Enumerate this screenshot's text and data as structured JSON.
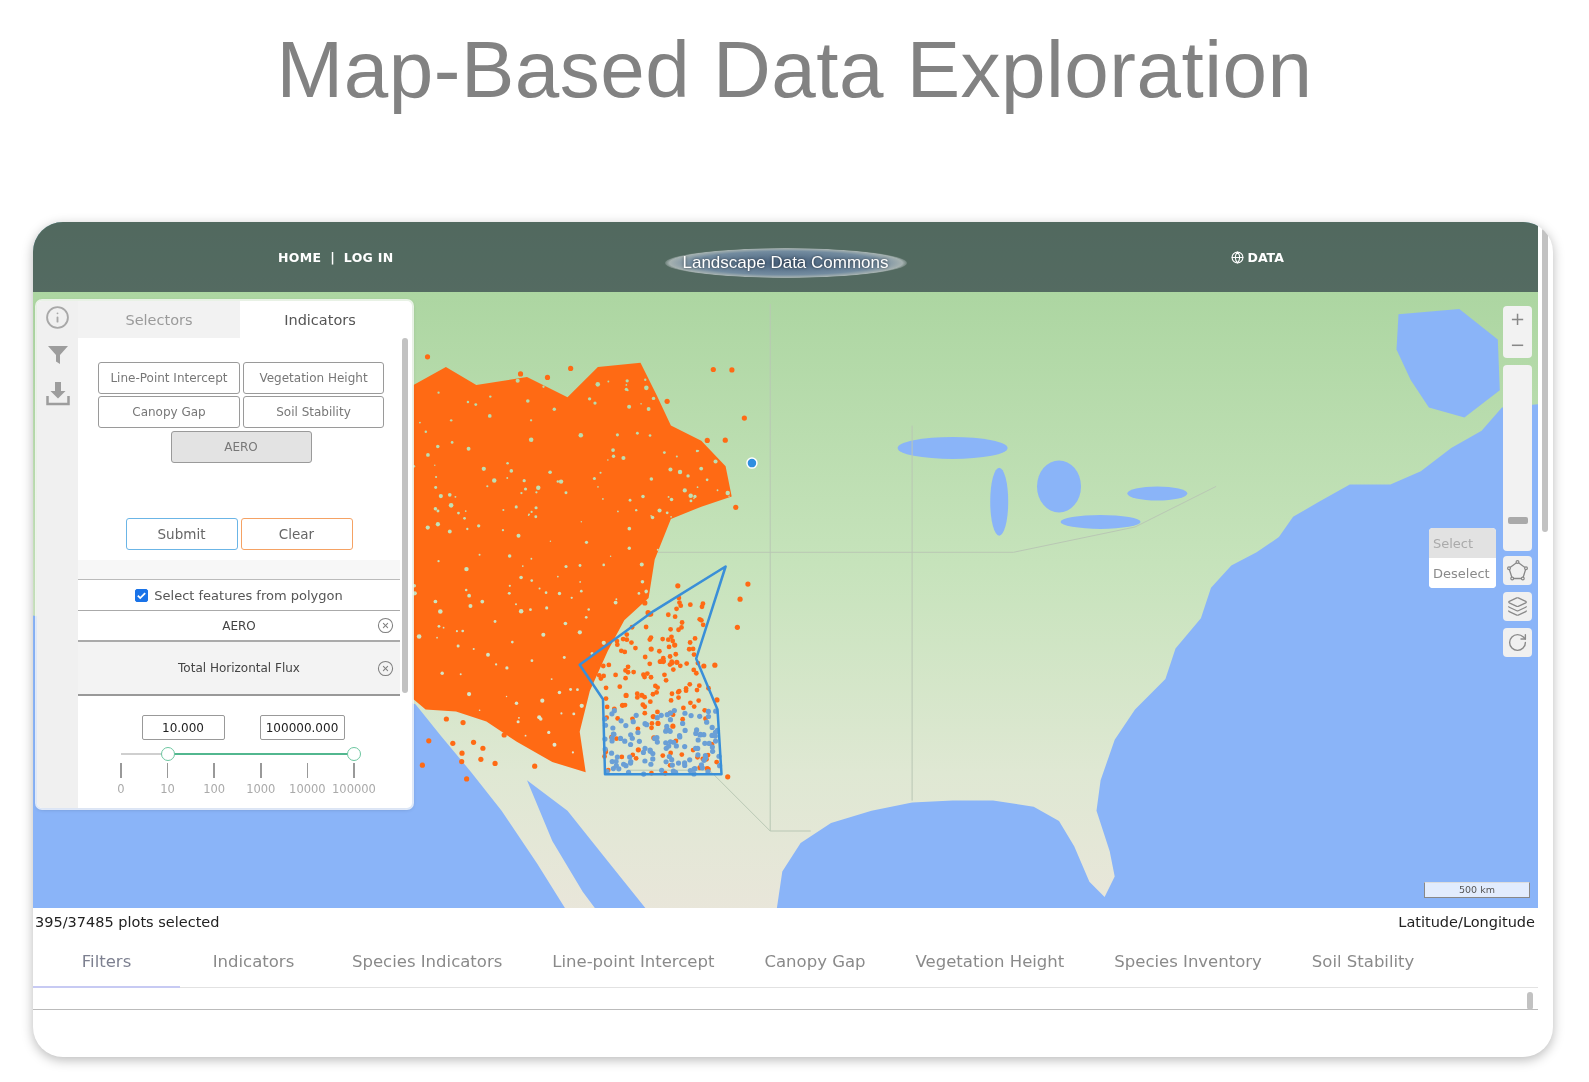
{
  "page_title": "Map-Based Data Exploration",
  "header": {
    "nav": [
      {
        "kind": "link",
        "label": "HOME"
      },
      {
        "kind": "separator",
        "label": "|"
      },
      {
        "kind": "link",
        "label": "LOG IN"
      }
    ],
    "logo": "Landscape Data Commons",
    "data_link": "DATA"
  },
  "side_panel": {
    "tabs": [
      {
        "label": "Selectors",
        "selected": false
      },
      {
        "label": "Indicators",
        "selected": true
      }
    ],
    "indicator_buttons": [
      {
        "label": "Line-Point Intercept",
        "selected": false
      },
      {
        "label": "Vegetation Height",
        "selected": false
      },
      {
        "label": "Canopy Gap",
        "selected": false
      },
      {
        "label": "Soil Stability",
        "selected": false
      },
      {
        "label": "AERO",
        "selected": true
      }
    ],
    "actions": [
      {
        "kind": "submit",
        "label": "Submit"
      },
      {
        "kind": "clear",
        "label": "Clear"
      }
    ],
    "polygon_checkbox": {
      "label": "Select features from polygon",
      "checked": true
    },
    "filter_group": {
      "label": "AERO"
    },
    "filter": {
      "label": "Total Horizontal Flux",
      "min_value": "10.000",
      "max_value": "100000.000",
      "thumbs": [
        {
          "level": 0.2
        },
        {
          "level": 1
        }
      ],
      "ticks": [
        "0",
        "10",
        "100",
        "1000",
        "10000",
        "100000"
      ]
    }
  },
  "map_controls": {
    "zoom_in": "+",
    "zoom_out": "−",
    "zoom_slider": {
      "level": 0.13
    },
    "selection_menu": [
      {
        "label": "Select",
        "selected": true
      },
      {
        "label": "Deselect",
        "selected": false
      }
    ],
    "scale": "500 km"
  },
  "status_bar": {
    "selection": "395/37485 plots selected",
    "coordinates": "Latitude/Longitude"
  },
  "bottom_tabs": [
    {
      "label": "Filters",
      "selected": true
    },
    {
      "label": "Indicators",
      "selected": false
    },
    {
      "label": "Species Indicators",
      "selected": false
    },
    {
      "label": "Line-point Intercept",
      "selected": false
    },
    {
      "label": "Canopy Gap",
      "selected": false
    },
    {
      "label": "Vegetation Height",
      "selected": false
    },
    {
      "label": "Species Inventory",
      "selected": false
    },
    {
      "label": "Soil Stability",
      "selected": false
    }
  ]
}
